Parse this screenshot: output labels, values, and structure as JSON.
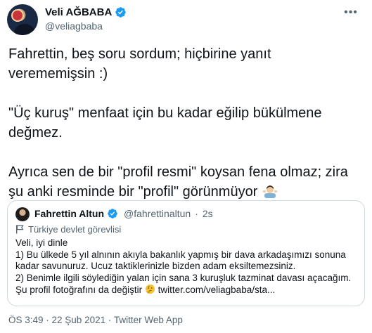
{
  "author": {
    "name": "Veli AĞBABA",
    "handle": "@veliagbaba"
  },
  "tweet": {
    "paragraphs": [
      [
        "Fahrettin, beş soru sordum; hiçbirine yanıt",
        "verememişsin :)"
      ],
      [
        "\"Üç kuruş\" menfaat için bu kadar eğilip bükülmene",
        "değmez."
      ],
      [
        "Ayrıca sen de bir \"profil resmi\" koysan fena olmaz; zira",
        "şu anki resminde bir \"profil\" görünmüyor"
      ]
    ]
  },
  "quote": {
    "name": "Fahrettin Altun",
    "handle": "@fahrettinaltun",
    "separator": "·",
    "time": "2s",
    "label": "Türkiye devlet görevlisi",
    "lines": [
      "Veli, iyi dinle",
      "1) Bu ülkede 5 yıl alnının akıyla bakanlık yapmış bir dava arkadaşımızı sonuna",
      "kadar savunuruz. Ucuz taktiklerinizle bizden adam eksiltemezsiniz.",
      "2) Benimle ilgili söylediğin yalan için sana 3 kuruşluk tazminat davası açacağım.",
      "Şu profil fotoğrafını da değiştir",
      "twitter.com/veliagbaba/sta..."
    ]
  },
  "meta": {
    "timestamp": "ÖS 3:49 · 22 Şub 2021 · Twitter Web App"
  },
  "colors": {
    "verified": "#1d9bf0",
    "secondary_text": "#536471",
    "border": "#cfd9de"
  }
}
